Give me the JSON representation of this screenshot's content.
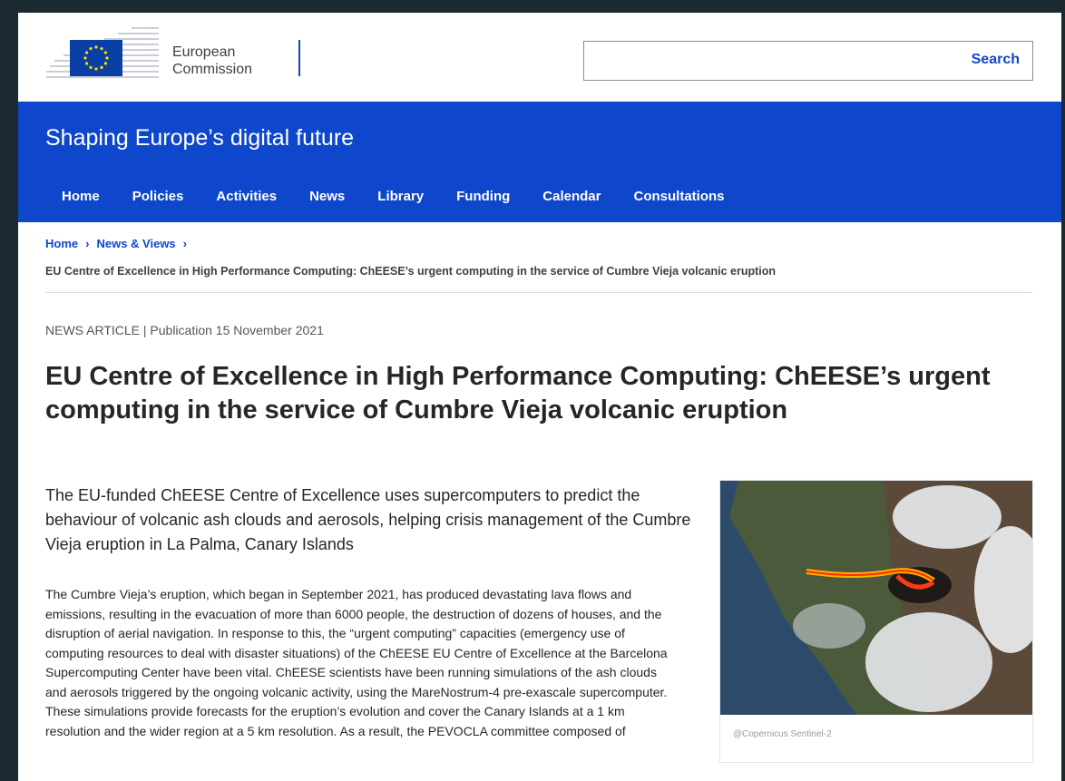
{
  "header": {
    "logo_line1": "European",
    "logo_line2": "Commission",
    "search_label": "Search",
    "search_placeholder": ""
  },
  "site": {
    "title": "Shaping Europe’s digital future",
    "nav": [
      "Home",
      "Policies",
      "Activities",
      "News",
      "Library",
      "Funding",
      "Calendar",
      "Consultations"
    ]
  },
  "breadcrumb": {
    "items": [
      "Home",
      "News & Views"
    ],
    "current": "EU Centre of Excellence in High Performance Computing: ChEESE’s urgent computing in the service of Cumbre Vieja volcanic eruption"
  },
  "article": {
    "meta": "NEWS ARTICLE | Publication 15 November 2021",
    "title": "EU Centre of Excellence in High Performance Computing: ChEESE’s urgent computing in the service of Cumbre Vieja volcanic eruption",
    "lead": "The EU-funded ChEESE Centre of Excellence uses supercomputers to predict the behaviour of volcanic ash clouds and aerosols, helping crisis management of the Cumbre Vieja eruption in La Palma, Canary Islands",
    "body": "The Cumbre Vieja’s eruption, which began in September 2021, has produced devastating lava flows and emissions, resulting in the evacuation of more than 6000 people, the destruction of dozens of houses, and the disruption of aerial navigation.  In response to this, the “urgent computing” capacities (emergency use of computing resources to deal with disaster situations) of the ChEESE EU Centre of Excellence at the Barcelona Supercomputing Center have been vital. ChEESE scientists have been running simulations of the ash clouds and aerosols triggered by the ongoing volcanic activity, using the MareNostrum-4 pre-exascale supercomputer. These simulations provide forecasts for the eruption’s evolution and cover the Canary Islands at a 1 km resolution and the wider region at a 5 km resolution. As a result, the PEVOCLA committee composed of",
    "image_caption": "@Copernicus Sentinel-2"
  },
  "colors": {
    "brand_blue": "#0e47cb",
    "text": "#262626"
  }
}
